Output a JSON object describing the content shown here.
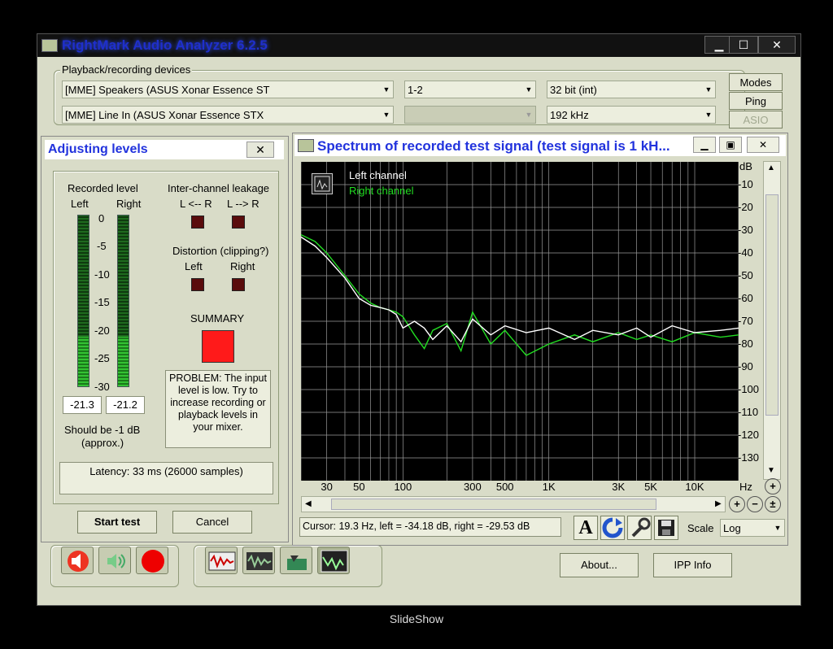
{
  "app": {
    "title": "RightMark Audio Analyzer 6.2.5"
  },
  "window_controls": {
    "minimize": "▁",
    "maximize": "☐",
    "close": "✕"
  },
  "devices": {
    "group_label": "Playback/recording devices",
    "playback_device": "[MME] Speakers (ASUS Xonar Essence ST",
    "playback_channels": "1-2",
    "bit_depth": "32 bit (int)",
    "recording_device": "[MME] Line In (ASUS Xonar Essence STX",
    "recording_channels": "",
    "sample_rate": "192 kHz",
    "modes_label": "Modes",
    "ping_label": "Ping",
    "asio_label": "ASIO"
  },
  "adjust": {
    "title": "Adjusting levels",
    "close": "✕",
    "recorded_level_label": "Recorded level",
    "left_label": "Left",
    "right_label": "Right",
    "scale": [
      "0",
      "-5",
      "-10",
      "-15",
      "-20",
      "-25",
      "-30"
    ],
    "left_value": "-21.3",
    "right_value": "-21.2",
    "left_level_fraction": 0.29,
    "right_level_fraction": 0.29,
    "should_be": "Should be  -1 dB",
    "approx": "(approx.)",
    "leakage_label": "Inter-channel leakage",
    "leakage_lr": "L <-- R",
    "leakage_rl": "L --> R",
    "distortion_label": "Distortion (clipping?)",
    "dist_left": "Left",
    "dist_right": "Right",
    "summary_label": "SUMMARY",
    "problem_text": "PROBLEM: The input level is low. Try to increase recording or playback levels in your mixer.",
    "latency": "Latency: 33 ms (26000 samples)",
    "start_label": "Start test",
    "cancel_label": "Cancel",
    "summary_color": "#ff1a1a"
  },
  "spectrum": {
    "title": "Spectrum of recorded test signal (test signal is 1 kH...",
    "legend_left": "Left channel",
    "legend_right": "Right channel",
    "db_unit": "dB",
    "hz_unit": "Hz",
    "y_ticks": [
      "-10",
      "-20",
      "-30",
      "-40",
      "-50",
      "-60",
      "-70",
      "-80",
      "-90",
      "-100",
      "-110",
      "-120",
      "-130"
    ],
    "x_ticks": [
      "30",
      "50",
      "100",
      "300",
      "500",
      "1K",
      "3K",
      "5K",
      "10K"
    ],
    "cursor": "Cursor:  19.3 Hz,  left = -34.18 dB,  right = -29.53 dB",
    "scale_label": "Scale",
    "scale_value": "Log",
    "left_color": "#ffffff",
    "right_color": "#22dd22"
  },
  "chart_data": {
    "type": "line",
    "xlabel": "Hz",
    "ylabel": "dB",
    "x_scale": "log",
    "xlim": [
      20,
      20000
    ],
    "ylim": [
      -140,
      0
    ],
    "grid": true,
    "legend": "top-left",
    "series": [
      {
        "name": "Left channel",
        "x": [
          20,
          25,
          30,
          40,
          50,
          60,
          70,
          80,
          90,
          100,
          120,
          140,
          160,
          200,
          250,
          300,
          400,
          500,
          700,
          1000,
          1500,
          2000,
          3000,
          4000,
          5000,
          7000,
          10000,
          15000,
          20000
        ],
        "y": [
          -33,
          -37,
          -42,
          -51,
          -60,
          -63,
          -64,
          -65,
          -67,
          -73,
          -70,
          -73,
          -78,
          -72,
          -79,
          -69,
          -76,
          -72,
          -75,
          -73,
          -78,
          -74,
          -76,
          -73,
          -77,
          -72,
          -75,
          -74,
          -73
        ]
      },
      {
        "name": "Right channel",
        "x": [
          20,
          25,
          30,
          40,
          50,
          60,
          70,
          80,
          90,
          100,
          120,
          140,
          160,
          200,
          250,
          300,
          400,
          500,
          700,
          1000,
          1500,
          2000,
          3000,
          4000,
          5000,
          7000,
          10000,
          15000,
          20000
        ],
        "y": [
          -32,
          -35,
          -40,
          -50,
          -58,
          -62,
          -64,
          -65,
          -66,
          -68,
          -76,
          -82,
          -74,
          -71,
          -83,
          -66,
          -80,
          -74,
          -85,
          -80,
          -76,
          -79,
          -75,
          -78,
          -76,
          -79,
          -75,
          -77,
          -76
        ]
      }
    ]
  },
  "bottom": {
    "about_label": "About...",
    "ipp_label": "IPP Info"
  },
  "caption": "SlideShow"
}
